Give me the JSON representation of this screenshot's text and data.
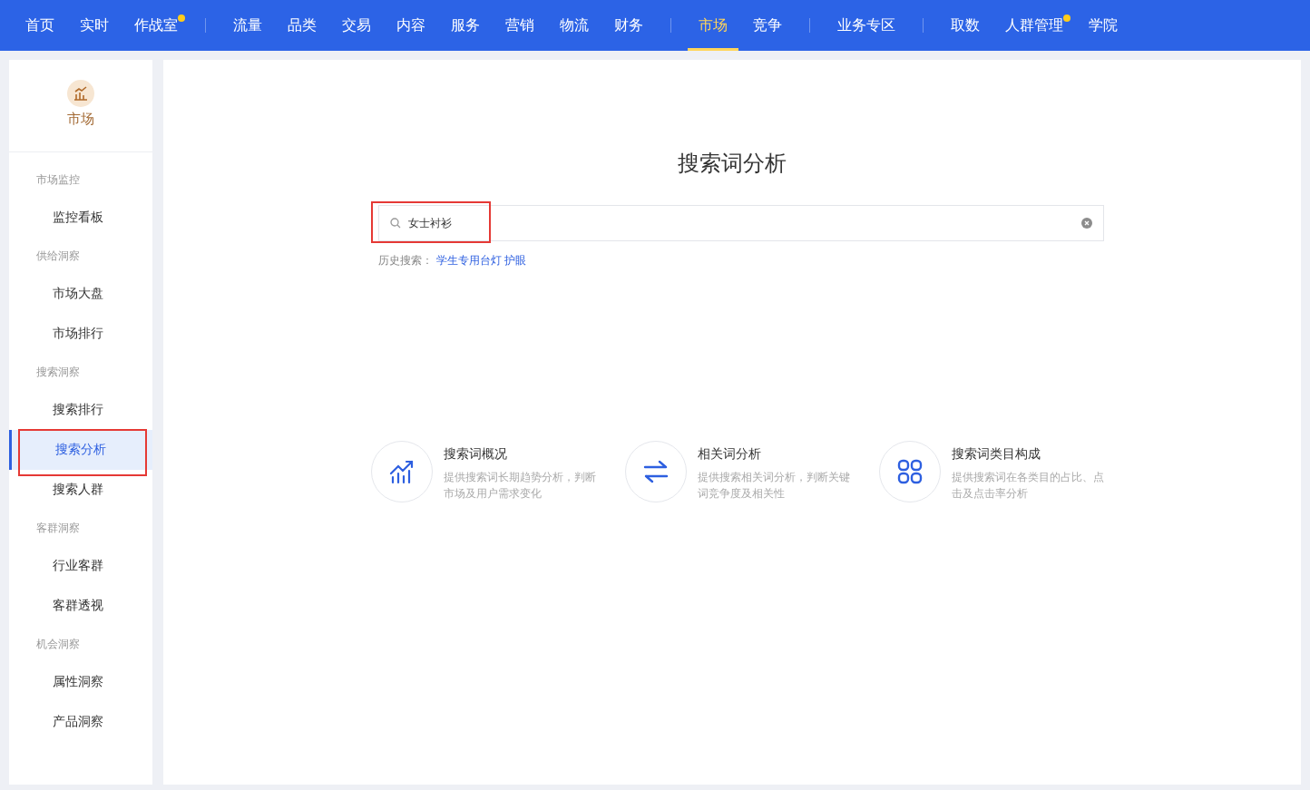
{
  "nav": {
    "groups": [
      [
        {
          "label": "首页",
          "selected": false,
          "dot": false
        },
        {
          "label": "实时",
          "selected": false,
          "dot": false
        },
        {
          "label": "作战室",
          "selected": false,
          "dot": true
        }
      ],
      [
        {
          "label": "流量",
          "selected": false,
          "dot": false
        },
        {
          "label": "品类",
          "selected": false,
          "dot": false
        },
        {
          "label": "交易",
          "selected": false,
          "dot": false
        },
        {
          "label": "内容",
          "selected": false,
          "dot": false
        },
        {
          "label": "服务",
          "selected": false,
          "dot": false
        },
        {
          "label": "营销",
          "selected": false,
          "dot": false
        },
        {
          "label": "物流",
          "selected": false,
          "dot": false
        },
        {
          "label": "财务",
          "selected": false,
          "dot": false
        }
      ],
      [
        {
          "label": "市场",
          "selected": true,
          "dot": false
        },
        {
          "label": "竞争",
          "selected": false,
          "dot": false
        }
      ],
      [
        {
          "label": "业务专区",
          "selected": false,
          "dot": false
        }
      ],
      [
        {
          "label": "取数",
          "selected": false,
          "dot": false
        },
        {
          "label": "人群管理",
          "selected": false,
          "dot": true
        },
        {
          "label": "学院",
          "selected": false,
          "dot": false
        }
      ]
    ]
  },
  "sidebar": {
    "title": "市场",
    "sections": [
      {
        "heading": "市场监控",
        "items": [
          {
            "label": "监控看板",
            "selected": false,
            "annotated": false
          }
        ]
      },
      {
        "heading": "供给洞察",
        "items": [
          {
            "label": "市场大盘",
            "selected": false,
            "annotated": false
          },
          {
            "label": "市场排行",
            "selected": false,
            "annotated": false
          }
        ]
      },
      {
        "heading": "搜索洞察",
        "items": [
          {
            "label": "搜索排行",
            "selected": false,
            "annotated": false
          },
          {
            "label": "搜索分析",
            "selected": true,
            "annotated": true
          },
          {
            "label": "搜索人群",
            "selected": false,
            "annotated": false
          }
        ]
      },
      {
        "heading": "客群洞察",
        "items": [
          {
            "label": "行业客群",
            "selected": false,
            "annotated": false
          },
          {
            "label": "客群透视",
            "selected": false,
            "annotated": false
          }
        ]
      },
      {
        "heading": "机会洞察",
        "items": [
          {
            "label": "属性洞察",
            "selected": false,
            "annotated": false
          },
          {
            "label": "产品洞察",
            "selected": false,
            "annotated": false
          }
        ]
      }
    ]
  },
  "main": {
    "title": "搜索词分析",
    "search": {
      "value": "女士衬衫",
      "annotated": true
    },
    "history": {
      "label": "历史搜索：",
      "links": [
        "学生专用台灯 护眼"
      ]
    },
    "cards": [
      {
        "kind": "trend",
        "title": "搜索词概况",
        "description": "提供搜索词长期趋势分析，判断市场及用户需求变化"
      },
      {
        "kind": "swap",
        "title": "相关词分析",
        "description": "提供搜索相关词分析，判断关键词竞争度及相关性"
      },
      {
        "kind": "grid",
        "title": "搜索词类目构成",
        "description": "提供搜索词在各类目的占比、点击及点击率分析"
      }
    ]
  }
}
